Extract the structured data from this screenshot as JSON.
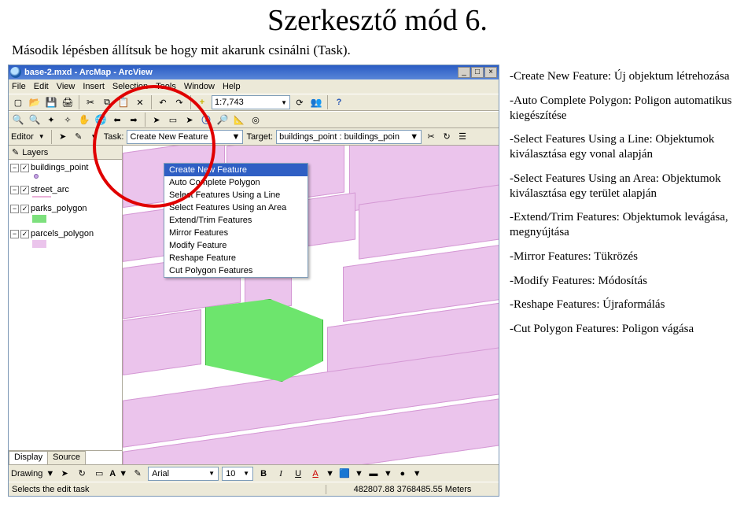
{
  "page": {
    "title": "Szerkesztő mód 6.",
    "subtitle": "Második lépésben állítsuk be hogy mit akarunk csinálni (Task)."
  },
  "window": {
    "title": "base-2.mxd - ArcMap - ArcView",
    "winbtns": {
      "min": "_",
      "max": "□",
      "close": "×"
    }
  },
  "menu": {
    "file": "File",
    "edit": "Edit",
    "view": "View",
    "insert": "Insert",
    "selection": "Selection",
    "tools": "Tools",
    "window": "Window",
    "help": "Help"
  },
  "toolbar": {
    "scale": "1:7,743"
  },
  "editbar": {
    "editor": "Editor",
    "taskLabel": "Task:",
    "taskValue": "Create New Feature",
    "targetLabel": "Target:",
    "targetValue": "buildings_point : buildings_poin"
  },
  "contextMenu": {
    "items": [
      "Create New Feature",
      "Auto Complete Polygon",
      "Select Features Using a Line",
      "Select Features Using an Area",
      "Extend/Trim Features",
      "Mirror Features",
      "Modify Feature",
      "Reshape Feature",
      "Cut Polygon Features"
    ]
  },
  "toc": {
    "header": "Layers",
    "items": [
      "buildings_point",
      "street_arc",
      "parks_polygon",
      "parcels_polygon"
    ],
    "tabs": {
      "display": "Display",
      "source": "Source"
    }
  },
  "drawbar": {
    "label": "Drawing",
    "font": "Arial",
    "size": "10",
    "bold": "B",
    "italic": "I",
    "underline": "U",
    "aglyph": "A"
  },
  "status": {
    "task": "Selects the edit task",
    "coords": "482807.88 3768485.55 Meters"
  },
  "side": {
    "p1": "-Create New Feature: Új objektum létrehozása",
    "p2": "-Auto Complete Polygon: Poligon automatikus kiegészítése",
    "p3": "-Select Features Using a Line: Objektumok kiválasztása egy vonal alapján",
    "p4": "-Select Features Using an Area: Objektumok kiválasztása egy terület alapján",
    "p5": "-Extend/Trim Features: Objektumok levágása, megnyújtása",
    "p6": "-Mirror Features: Tükrözés",
    "p7": "-Modify Features: Módosítás",
    "p8": "-Reshape Features: Újraformálás",
    "p9": "-Cut Polygon Features: Poligon vágása"
  }
}
